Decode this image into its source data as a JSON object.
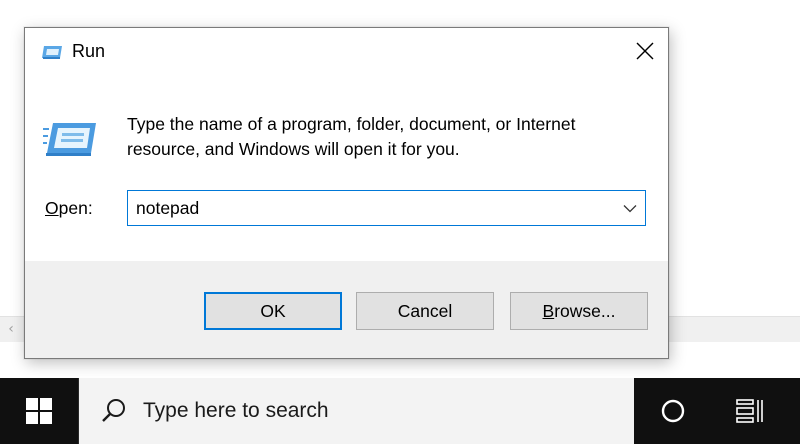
{
  "dialog": {
    "title": "Run",
    "description": "Type the name of a program, folder, document, or Internet resource, and Windows will open it for you.",
    "open_label_access": "O",
    "open_label_rest": "pen:",
    "open_value": "notepad",
    "buttons": {
      "ok": "OK",
      "cancel": "Cancel",
      "browse_access": "B",
      "browse_rest": "rowse..."
    },
    "icons": {
      "title": "run-icon",
      "large": "run-icon",
      "close": "close-icon",
      "dropdown": "chevron-down-icon"
    }
  },
  "taskbar": {
    "search_placeholder": "Type here to search",
    "icons": {
      "start": "windows-logo-icon",
      "search": "search-icon",
      "cortana": "cortana-circle-icon",
      "task_view": "task-view-icon"
    }
  },
  "background": {
    "scroll_left_icon": "scroll-left-arrow-icon"
  },
  "colors": {
    "accent": "#0078d7",
    "taskbar": "#101010",
    "button_bar": "#f0f0f0",
    "button_face": "#e1e1e1"
  }
}
